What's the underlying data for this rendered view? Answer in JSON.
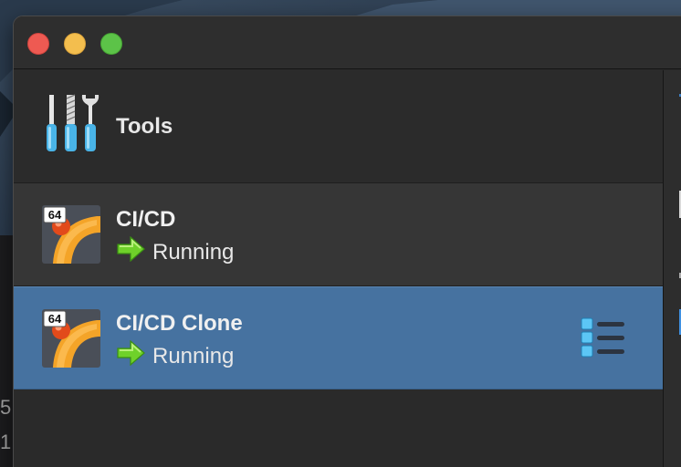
{
  "desktop": {
    "background_glyphs": [
      "5",
      "1:"
    ]
  },
  "window": {
    "traffic_lights": [
      "close",
      "minimize",
      "zoom"
    ]
  },
  "sidebar": {
    "tools": {
      "label": "Tools",
      "icon": "screwdrivers-icon"
    },
    "vms": [
      {
        "name": "CI/CD",
        "status": "Running",
        "badge": "64",
        "icon": "vm-os-icon",
        "status_icon": "green-arrow-icon",
        "selected": false
      },
      {
        "name": "CI/CD Clone",
        "status": "Running",
        "badge": "64",
        "icon": "vm-os-icon",
        "status_icon": "green-arrow-icon",
        "selected": true
      }
    ]
  },
  "colors": {
    "selected_row": "#4672a0",
    "row": "#363636",
    "status_arrow": "#6fd12a"
  }
}
